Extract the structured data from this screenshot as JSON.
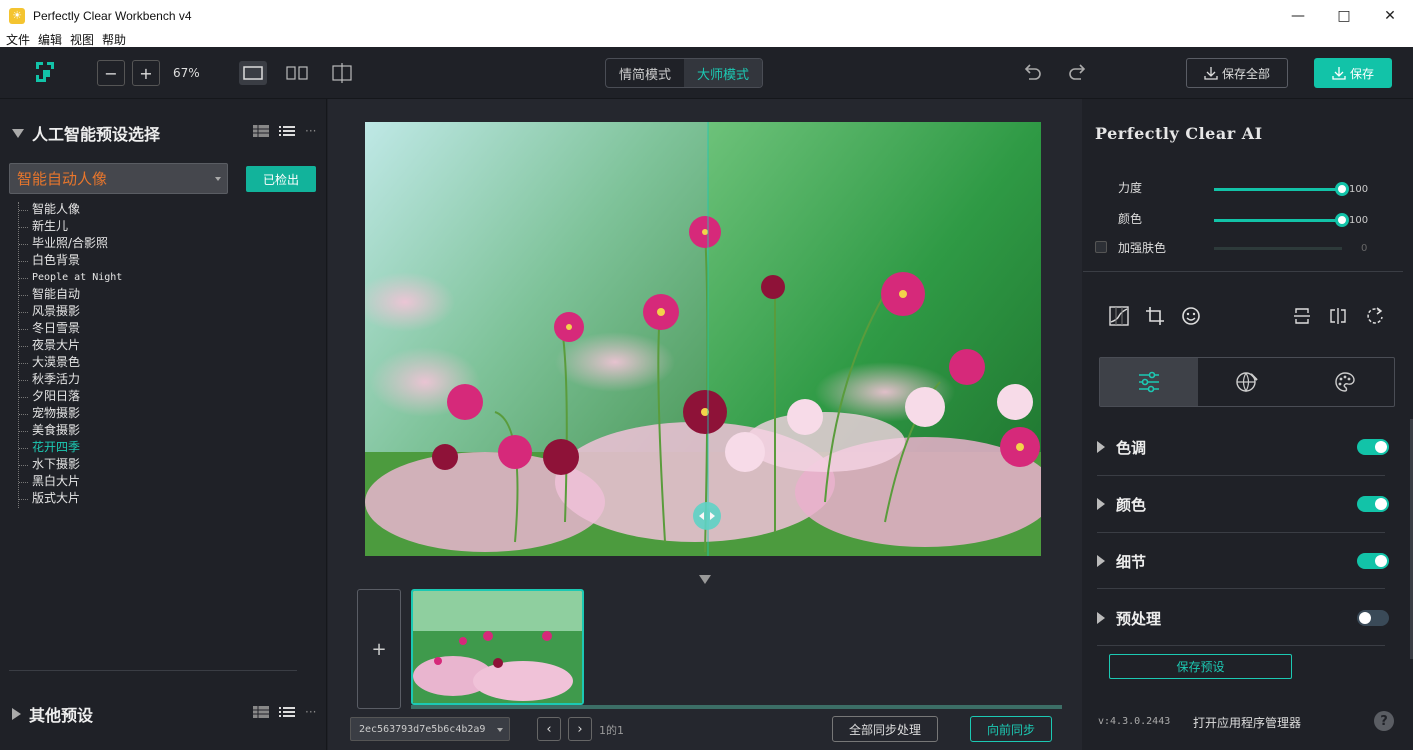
{
  "window": {
    "title": "Perfectly Clear Workbench v4",
    "app_icon": "sun-icon"
  },
  "menubar": {
    "items": [
      "文件",
      "编辑",
      "视图",
      "帮助"
    ]
  },
  "toolbar": {
    "zoom_out": "−",
    "zoom_in": "+",
    "zoom_value": "67%",
    "modes": [
      "情简模式",
      "大师模式"
    ],
    "active_mode": "大师模式",
    "save_all_label": "保存全部",
    "save_label": "保存",
    "accent_color": "#12c3a8"
  },
  "left_panel": {
    "ai_section_title": "人工智能预设选择",
    "selected_preset": "智能自动人像",
    "checkout_label": "已检出",
    "presets": [
      "智能人像",
      "新生儿",
      "毕业照/合影照",
      "白色背景",
      "People at Night",
      "智能自动",
      "风景摄影",
      "冬日雪景",
      "夜景大片",
      "大漠景色",
      "秋季活力",
      "夕阳日落",
      "宠物摄影",
      "美食摄影",
      "花开四季",
      "水下摄影",
      "黑白大片",
      "版式大片"
    ],
    "highlighted_preset": "花开四季",
    "other_section_title": "其他预设",
    "more": "···"
  },
  "center": {
    "add_label": "+",
    "image_id": "2ec563793d7e5b6c4b2a9",
    "prev": "‹",
    "next": "›",
    "page_info": "1的1",
    "sync_all_label": "全部同步处理",
    "sync_forward_label": "向前同步"
  },
  "right_panel": {
    "title": "Perfectly Clear AI",
    "sliders": [
      {
        "label": "力度",
        "value": "100",
        "level": 1.0,
        "enabled": true
      },
      {
        "label": "颜色",
        "value": "100",
        "level": 1.0,
        "enabled": true
      },
      {
        "label": "加强肤色",
        "value": "0",
        "level": 0.0,
        "enabled": false
      }
    ],
    "tools": [
      "curves-icon",
      "crop-icon",
      "face-icon",
      "flip-vertical-icon",
      "flip-horizontal-icon",
      "rotate-icon"
    ],
    "tabs": [
      "sliders-icon",
      "globe-brush-icon",
      "palette-icon"
    ],
    "adjustments": [
      {
        "label": "色调",
        "on": true
      },
      {
        "label": "颜色",
        "on": true
      },
      {
        "label": "细节",
        "on": true
      },
      {
        "label": "预处理",
        "on": false
      }
    ],
    "save_preset_label": "保存预设",
    "version": "v:4.3.0.2443",
    "app_manager_label": "打开应用程序管理器",
    "help": "?"
  }
}
